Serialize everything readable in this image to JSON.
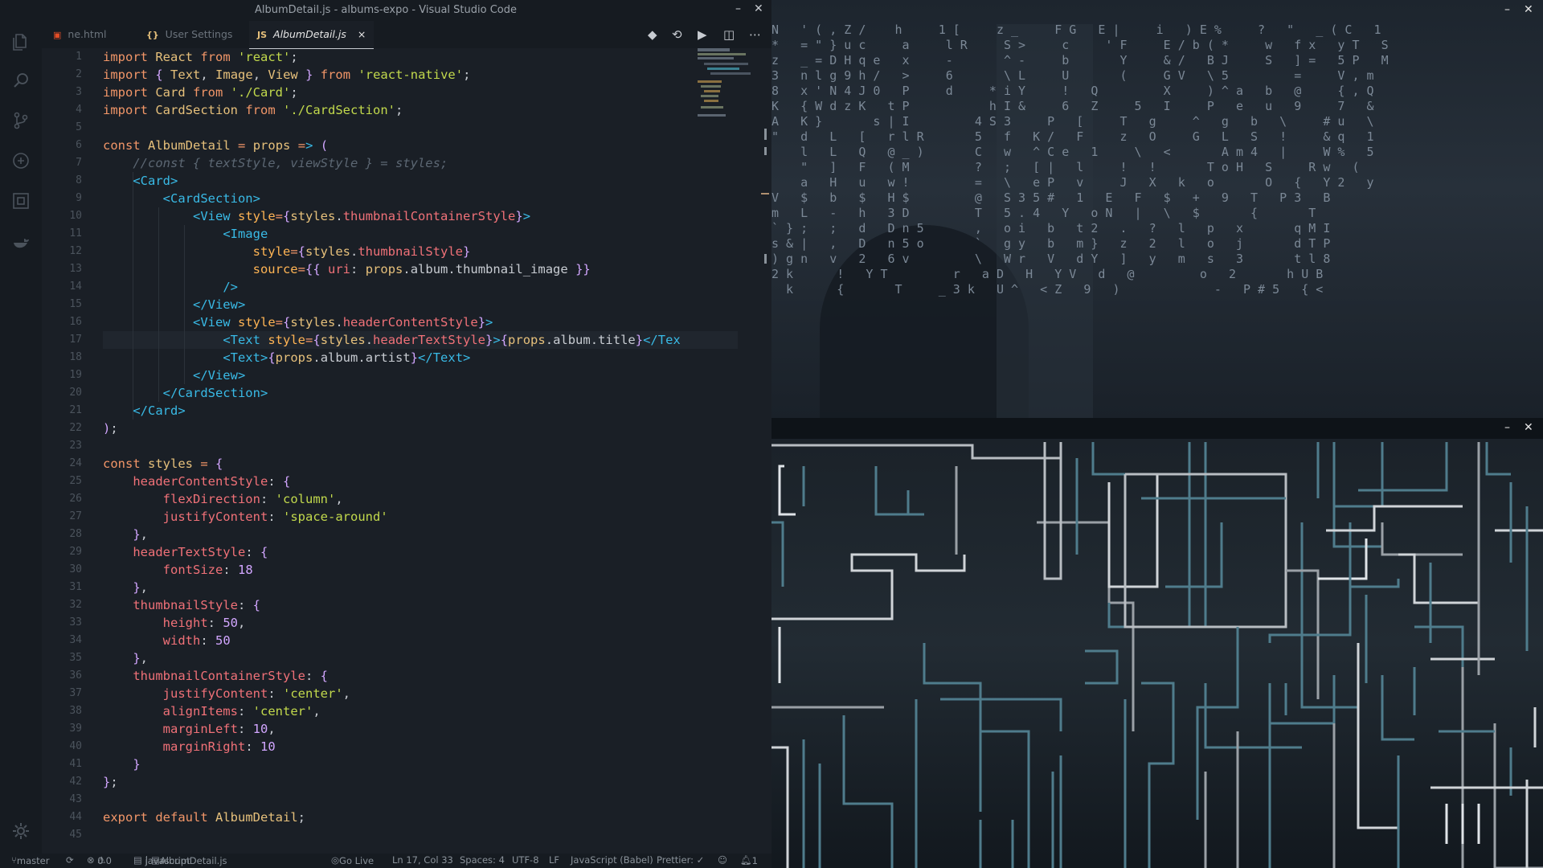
{
  "window": {
    "title": "AlbumDetail.js - albums-expo - Visual Studio Code",
    "minimize": "–",
    "close": "✕"
  },
  "activity_bar": {
    "items": [
      "explorer-icon",
      "search-icon",
      "source-control-icon",
      "debug-icon",
      "extensions-icon",
      "docker-icon"
    ],
    "bottom": "gear-icon"
  },
  "tabs": [
    {
      "icon": "html5-icon",
      "label": "ne.html",
      "active": false
    },
    {
      "icon": "json-icon",
      "icon_text": "{}",
      "label": "User Settings",
      "active": false
    },
    {
      "icon": "js-icon",
      "icon_text": "JS",
      "label": "AlbumDetail.js",
      "active": true,
      "close": "×"
    }
  ],
  "editor_actions": [
    "diff-icon",
    "compare-icon",
    "run-icon",
    "split-editor-icon",
    "more-icon"
  ],
  "editor": {
    "current_line": 17,
    "lines": [
      "import React from 'react';",
      "import { Text, Image, View } from 'react-native';",
      "import Card from './Card';",
      "import CardSection from './CardSection';",
      "",
      "const AlbumDetail = props => (",
      "    //const { textStyle, viewStyle } = styles;",
      "    <Card>",
      "        <CardSection>",
      "            <View style={styles.thumbnailContainerStyle}>",
      "                <Image",
      "                    style={styles.thumbnailStyle}",
      "                    source={{ uri: props.album.thumbnail_image }}",
      "                />",
      "            </View>",
      "            <View style={styles.headerContentStyle}>",
      "                <Text style={styles.headerTextStyle}>{props.album.title}</Tex",
      "                <Text>{props.album.artist}</Text>",
      "            </View>",
      "        </CardSection>",
      "    </Card>",
      ");",
      "",
      "const styles = {",
      "    headerContentStyle: {",
      "        flexDirection: 'column',",
      "        justifyContent: 'space-around'",
      "    },",
      "    headerTextStyle: {",
      "        fontSize: 18",
      "    },",
      "    thumbnailStyle: {",
      "        height: 50,",
      "        width: 50",
      "    },",
      "    thumbnailContainerStyle: {",
      "        justifyContent: 'center',",
      "        alignItems: 'center',",
      "        marginLeft: 10,",
      "        marginRight: 10",
      "    }",
      "};",
      "",
      "export default AlbumDetail;",
      ""
    ]
  },
  "statusbar": {
    "branch": "master",
    "errors": "0",
    "warnings": "0",
    "language_mode": "javascript",
    "file": "AlbumDetail.js",
    "go_live": "Go Live",
    "position": "Ln 17, Col 33",
    "spaces": "Spaces: 4",
    "encoding": "UTF-8",
    "eol": "LF",
    "language": "JavaScript (Babel)",
    "prettier": "Prettier: ✓",
    "notifications": "1"
  },
  "terminal_top": {
    "minimize": "–",
    "close": "✕",
    "rows": [
      "N   ' ( , Z /    h     1 [     z _     F G   E |     i   ) E %     ?   \"   _ ( C   1",
      "*   = \" } u c     a     l R     S >     c     ' F     E / b ( *     w   f x   y T   S",
      "z   _ = D H q e   x     -       ^ -     b       Y     & /   B J     S   ] =   5 P   M",
      "3   n l g 9 h /   >     6       \\ L     U       (     G V   \\ 5         =     V , m",
      "8   x ' N 4 J 0   P     d     * i Y     !   Q         X     ) ^ a   b   @     { , Q",
      "K   { W d z K   t P           h I &     6   Z     5   I     P   e   u   9     7   &",
      "A   K }       s | I         4 S 3     P   [     T   g     ^   g   b   \\     # u   \\",
      "\"   d   L   [   r l R       5   f   K /   F     z   O     G   L   S   !     & q   1",
      "    l   L   Q   @ _ )       C   w   ^ C e   1     \\   <       A m 4   |     W %   5",
      "    \"   ]   F   ( M         ?   ;   [ |   l     !   !       T o H   S     R w   (",
      "    a   H   u   w !         =   \\   e P   v     J   X   k   o       O   {   Y 2   y",
      "V   $   b   $   H $         @   S 3 5 #   1   E   F   $   +   9   T   P 3   B",
      "m   L   -   h   3 D         T   5 . 4   Y   o N   |   \\   $       {       T",
      "` } ;   ;   d   D n 5       ,   o i   b   t 2   .   ?   l   p   x       q M I",
      "s & |   ,   D   n 5 o       `   g y   b   m }   z   2   l   o   j       d T P",
      ") g n   v   2   6 v         \\   W r   V   d Y   ]   y   m   s   3       t l 8",
      "2 k      !   Y T         r   a D   H   Y V   d   @         o   2       h U B",
      "  k      {       T     _ 3 k   U ^   < Z   9   )             -   P # 5   { <"
    ]
  }
}
